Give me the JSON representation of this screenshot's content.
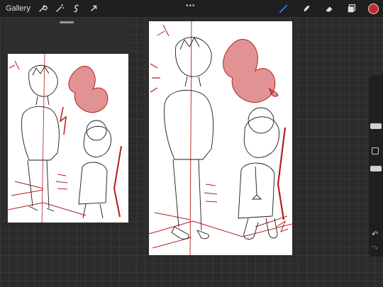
{
  "topbar": {
    "gallery_label": "Gallery",
    "dots_label": "•••",
    "left_tools": [
      "wrench-icon",
      "magic-wand-icon",
      "selection-icon",
      "transform-arrow-icon"
    ],
    "right_tools": [
      "brush-icon",
      "smudge-icon",
      "eraser-icon",
      "layers-icon"
    ],
    "active_tool_color": "#2f7cf6",
    "current_color": "#c62828"
  },
  "sidebar": {
    "undo_label": "↶",
    "redo_label": "↷"
  },
  "colors": {
    "line_art": "#1a1a1a",
    "sketch_red": "#b71c1c",
    "canvas_bg": "#ffffff",
    "workspace_bg": "#2b2b2b"
  }
}
